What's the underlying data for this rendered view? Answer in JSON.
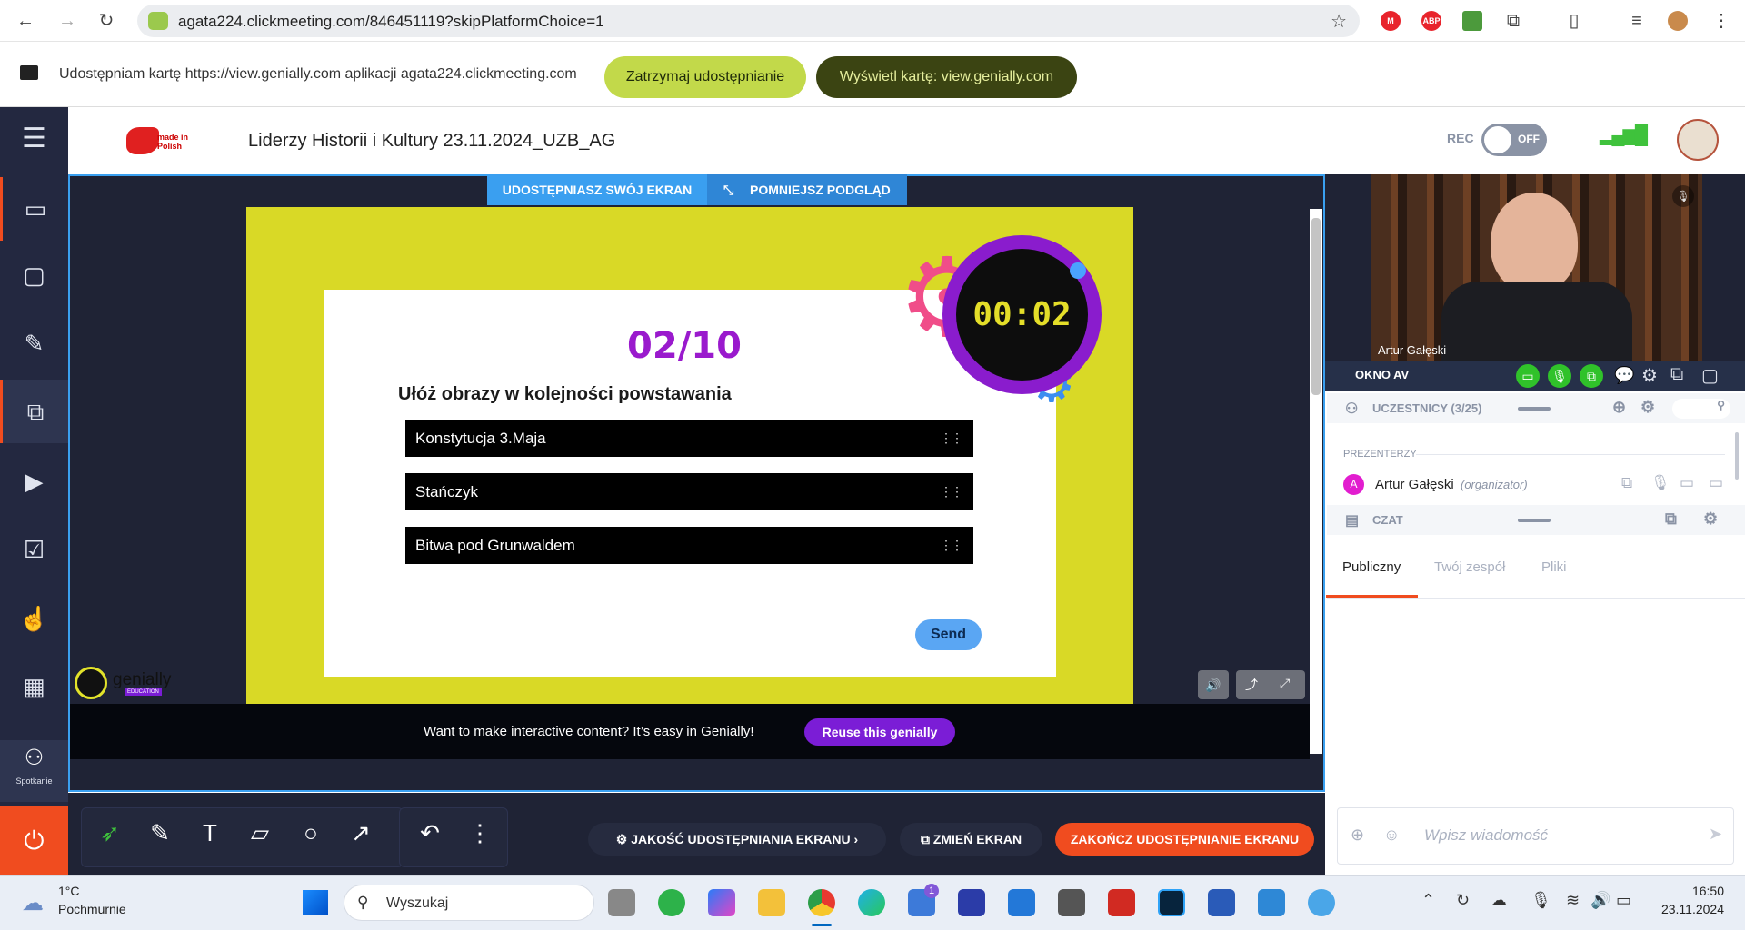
{
  "browser": {
    "url": "agata224.clickmeeting.com/846451119?skipPlatformChoice=1",
    "ext_abp": "ABP"
  },
  "sharebar": {
    "message": "Udostępniam kartę https://view.genially.com aplikacji agata224.clickmeeting.com",
    "stop_label": "Zatrzymaj udostępnianie",
    "view_label": "Wyświetl kartę: view.genially.com"
  },
  "app": {
    "logo_text": "made in Polish",
    "meeting_title": "Liderzy Historii i Kultury 23.11.2024_UZB_AG",
    "rec_label": "REC",
    "rec_toggle": "OFF"
  },
  "sidebar": {
    "spotkanie_label": "Spotkanie"
  },
  "stage": {
    "share_label": "UDOSTĘPNIASZ SWÓJ EKRAN",
    "shrink_label": "POMNIEJSZ PODGLĄD"
  },
  "slide": {
    "counter": "02/10",
    "timer": "00:02",
    "question": "Ułóż obrazy w kolejności powstawania",
    "items": [
      "Konstytucja 3.Maja",
      "Stańczyk",
      "Bitwa pod Grunwaldem"
    ],
    "send_label": "Send",
    "genially_logo": "genially",
    "genially_sub": "EDUCATION",
    "promo_text": "Want to make interactive content? It’s easy in Genially!",
    "reuse_label": "Reuse this genially"
  },
  "panel": {
    "video_name": "Artur Gałęski",
    "okno_label": "OKNO AV",
    "participants_label": "UCZESTNICY (3/25)",
    "presenters_label": "PREZENTERZY",
    "presenter_initial": "A",
    "presenter_name": "Artur Gałęski",
    "presenter_role": "(organizator)",
    "chat_label": "CZAT",
    "tabs": [
      "Publiczny",
      "Twój zespół",
      "Pliki"
    ],
    "message_placeholder": "Wpisz wiadomość"
  },
  "tools": {
    "quality_label": "JAKOŚĆ UDOSTĘPNIANIA EKRANU",
    "change_label": "ZMIEŃ EKRAN",
    "end_label": "ZAKOŃCZ UDOSTĘPNIANIE EKRANU"
  },
  "taskbar": {
    "temperature": "1°C",
    "weather": "Pochmurnie",
    "search_placeholder": "Wyszukaj",
    "badge": "1",
    "time": "16:50",
    "date": "23.11.2024"
  },
  "colors": {
    "accent_blue": "#3aa0f0",
    "slide_yellow": "#d9d926",
    "timer_purple": "#8a1ccd",
    "end_red": "#f04c1f",
    "sidebar_dark": "#232840"
  }
}
